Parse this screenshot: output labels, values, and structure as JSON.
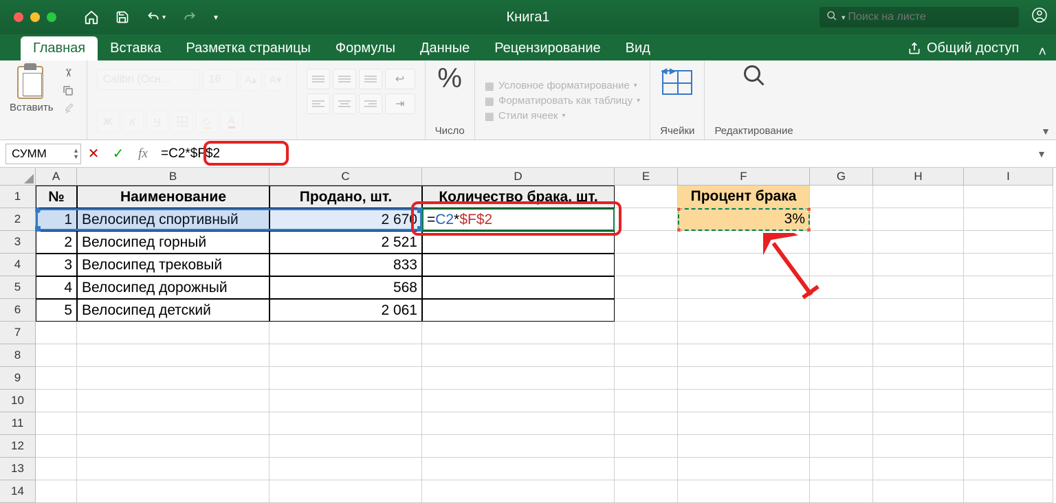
{
  "window": {
    "title": "Книга1"
  },
  "search": {
    "placeholder": "Поиск на листе"
  },
  "tabs": {
    "items": [
      "Главная",
      "Вставка",
      "Разметка страницы",
      "Формулы",
      "Данные",
      "Рецензирование",
      "Вид"
    ],
    "active": 0,
    "share": "Общий доступ"
  },
  "ribbon": {
    "paste": "Вставить",
    "font_name": "Calibri (Осн…",
    "font_size": "16",
    "bold": "Ж",
    "italic": "К",
    "underline": "Ч",
    "number": "Число",
    "styles": {
      "conditional": "Условное форматирование",
      "table": "Форматировать как таблицу",
      "cell": "Стили ячеек"
    },
    "cells": "Ячейки",
    "editing": "Редактирование"
  },
  "formula_bar": {
    "name_box": "СУММ",
    "formula": "=C2*$F$2"
  },
  "columns": [
    "A",
    "B",
    "C",
    "D",
    "E",
    "F",
    "G",
    "H",
    "I"
  ],
  "headers": {
    "A": "№",
    "B": "Наименование",
    "C": "Продано, шт.",
    "D": "Количество брака, шт.",
    "F": "Процент брака"
  },
  "data_rows": [
    {
      "n": "1",
      "name": "Велосипед спортивный",
      "sold": "2 670",
      "formula": {
        "ref1": "C2",
        "abs": "$F$2"
      }
    },
    {
      "n": "2",
      "name": "Велосипед горный",
      "sold": "2 521",
      "formula": null
    },
    {
      "n": "3",
      "name": "Велосипед трековый",
      "sold": "833",
      "formula": null
    },
    {
      "n": "4",
      "name": "Велосипед дорожный",
      "sold": "568",
      "formula": null
    },
    {
      "n": "5",
      "name": "Велосипед детский",
      "sold": "2 061",
      "formula": null
    }
  ],
  "percent_value": "3%",
  "blank_rows": [
    7,
    8,
    9,
    10,
    11,
    12,
    13,
    14
  ]
}
